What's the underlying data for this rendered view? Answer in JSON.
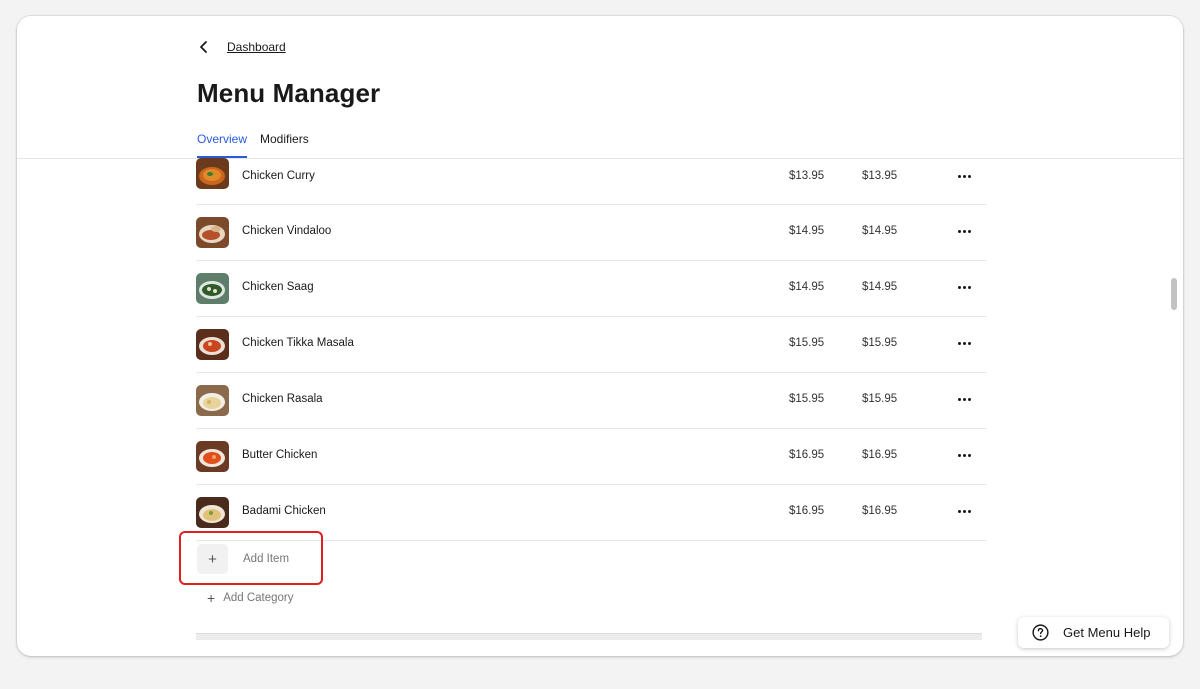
{
  "nav": {
    "back_label": "Dashboard"
  },
  "page": {
    "title": "Menu Manager"
  },
  "tabs": [
    {
      "label": "Overview",
      "active": true
    },
    {
      "label": "Modifiers",
      "active": false
    }
  ],
  "items": [
    {
      "name": "Chicken Curry",
      "price": "$13.95",
      "price2": "$13.95"
    },
    {
      "name": "Chicken Vindaloo",
      "price": "$14.95",
      "price2": "$14.95"
    },
    {
      "name": "Chicken Saag",
      "price": "$14.95",
      "price2": "$14.95"
    },
    {
      "name": "Chicken Tikka Masala",
      "price": "$15.95",
      "price2": "$15.95"
    },
    {
      "name": "Chicken Rasala",
      "price": "$15.95",
      "price2": "$15.95"
    },
    {
      "name": "Butter Chicken",
      "price": "$16.95",
      "price2": "$16.95"
    },
    {
      "name": "Badami Chicken",
      "price": "$16.95",
      "price2": "$16.95"
    }
  ],
  "actions": {
    "add_item_icon": "+",
    "add_item_label": "Add Item",
    "add_category_icon": "+",
    "add_category_label": "Add Category"
  },
  "help": {
    "label": "Get Menu Help",
    "icon": "question-circle-icon"
  },
  "colors": {
    "accent": "#2a5bd7",
    "highlight": "#e02020"
  }
}
